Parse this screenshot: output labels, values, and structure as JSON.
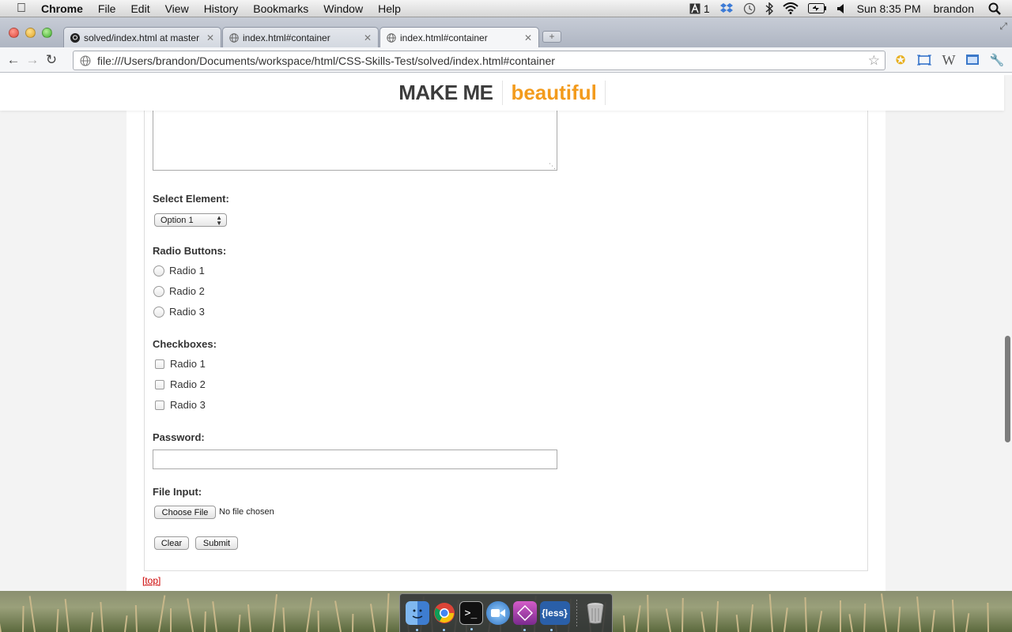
{
  "menubar": {
    "app_name": "Chrome",
    "items": [
      "File",
      "Edit",
      "View",
      "History",
      "Bookmarks",
      "Window",
      "Help"
    ],
    "adobe_badge": "1",
    "clock": "Sun 8:35 PM",
    "user": "brandon"
  },
  "tabs": [
    {
      "title": "solved/index.html at master",
      "favicon": "github-icon"
    },
    {
      "title": "index.html#container",
      "favicon": "globe-icon"
    },
    {
      "title": "index.html#container",
      "favicon": "globe-icon",
      "active": true
    }
  ],
  "address_bar": {
    "url": "file:///Users/brandon/Documents/workspace/html/CSS-Skills-Test/solved/index.html#container"
  },
  "page": {
    "logo_make": "MAKE ME",
    "logo_beautiful": "beautiful",
    "logo_colors": {
      "make": "#3c3c3c",
      "beautiful": "#f39b1c"
    },
    "select_label": "Select Element:",
    "select_value": "Option 1",
    "radio_label": "Radio Buttons:",
    "radios": [
      "Radio 1",
      "Radio 2",
      "Radio 3"
    ],
    "checkbox_label": "Checkboxes:",
    "checkboxes": [
      "Radio 1",
      "Radio 2",
      "Radio 3"
    ],
    "password_label": "Password:",
    "file_label": "File Input:",
    "file_button": "Choose File",
    "file_status": "No file chosen",
    "clear_button": "Clear",
    "submit_button": "Submit",
    "top_link": "[top]"
  },
  "dock": {
    "apps": [
      "finder-icon",
      "chrome-icon",
      "terminal-icon",
      "facetime-icon",
      "textmate-icon",
      "less-app-icon"
    ],
    "less_label": "{less}",
    "trash": "trash-icon"
  }
}
